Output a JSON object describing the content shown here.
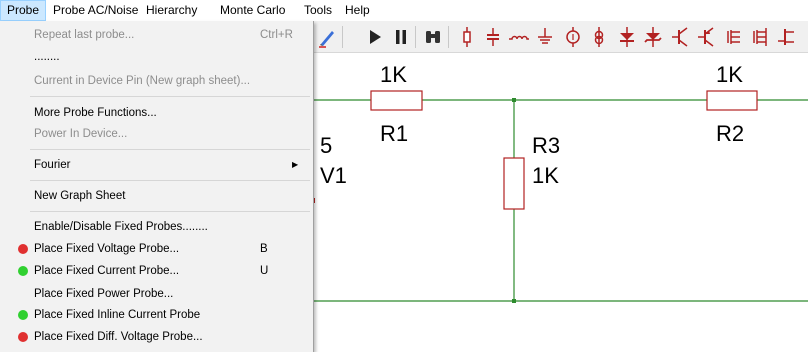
{
  "menubar": {
    "items": [
      "Probe",
      "Probe AC/Noise",
      "Hierarchy",
      "Monte Carlo",
      "Tools",
      "Help"
    ]
  },
  "probe_menu": {
    "repeat_last": {
      "label": "Repeat last probe...",
      "shortcut": "Ctrl+R"
    },
    "dots": "........",
    "current_in_pin": "Current in Device Pin (New graph sheet)...",
    "more_probe_functions": "More Probe Functions...",
    "power_in_device": "Power In Device...",
    "fourier": "Fourier",
    "new_graph_sheet": "New Graph Sheet",
    "enable_disable": "Enable/Disable Fixed Probes........",
    "fixed_voltage": {
      "label": "Place Fixed Voltage Probe...",
      "shortcut": "B",
      "dot_color": "#e03030"
    },
    "fixed_current": {
      "label": "Place Fixed Current Probe...",
      "shortcut": "U",
      "dot_color": "#30d030"
    },
    "fixed_power": {
      "label": "Place Fixed Power Probe..."
    },
    "fixed_inline_current": {
      "label": "Place Fixed Inline Current Probe",
      "dot_color": "#30d030"
    },
    "fixed_diff_voltage": {
      "label": "Place Fixed Diff. Voltage Probe...",
      "dot_color": "#e03030"
    }
  },
  "toolbar": {
    "icons": [
      "pencil-icon",
      "run-icon",
      "pause-icon",
      "binoculars-icon",
      "resistor-icon",
      "capacitor-icon",
      "inductor-icon",
      "ground-icon",
      "voltage-source-icon",
      "current-source-icon",
      "diode-icon",
      "zener-icon",
      "npn-transistor-icon",
      "pnp-transistor-icon",
      "nmos-icon",
      "pmos-icon",
      "jfet-icon"
    ]
  },
  "schematic": {
    "r1": {
      "name": "R1",
      "value": "1K"
    },
    "r2": {
      "name": "R2",
      "value": "1K"
    },
    "r3": {
      "name": "R3",
      "value": "1K"
    },
    "v1": {
      "name": "V1",
      "value": "5"
    },
    "wire_color": "#2e8b2e",
    "component_color": "#b22222"
  }
}
